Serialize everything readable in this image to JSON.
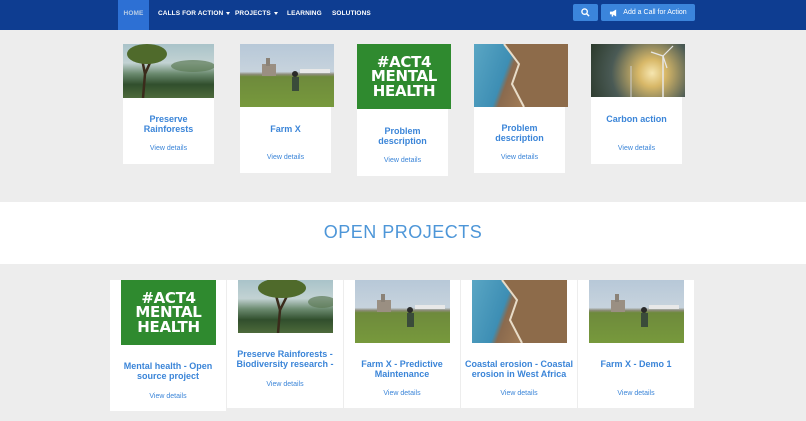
{
  "nav": {
    "home": "HOME",
    "calls_for_action": "CALLS FOR ACTION",
    "projects": "PROJECTS",
    "learning": "LEARNING",
    "solutions": "SOLUTIONS",
    "add_call": "Add a Call for Action"
  },
  "top_cards": [
    {
      "title": "Preserve Rainforests",
      "link": "View details"
    },
    {
      "title": "Farm X",
      "link": "View details"
    },
    {
      "title": "Problem description",
      "link": "View details"
    },
    {
      "title": "Problem description",
      "link": "View details"
    },
    {
      "title": "Carbon action",
      "link": "View details"
    }
  ],
  "section_title": "OPEN PROJECTS",
  "project_cards": [
    {
      "title": "Mental health - Open source project",
      "link": "View details"
    },
    {
      "title": "Preserve Rainforests - Biodiversity research -",
      "link": "View details"
    },
    {
      "title": "Farm X - Predictive Maintenance",
      "link": "View details"
    },
    {
      "title": "Coastal erosion - Coastal erosion in West Africa",
      "link": "View details"
    },
    {
      "title": "Farm X - Demo 1",
      "link": "View details"
    }
  ],
  "act_logo": {
    "line1": "#ACT4",
    "line2": "MENTAL",
    "line3": "HEALTH"
  }
}
